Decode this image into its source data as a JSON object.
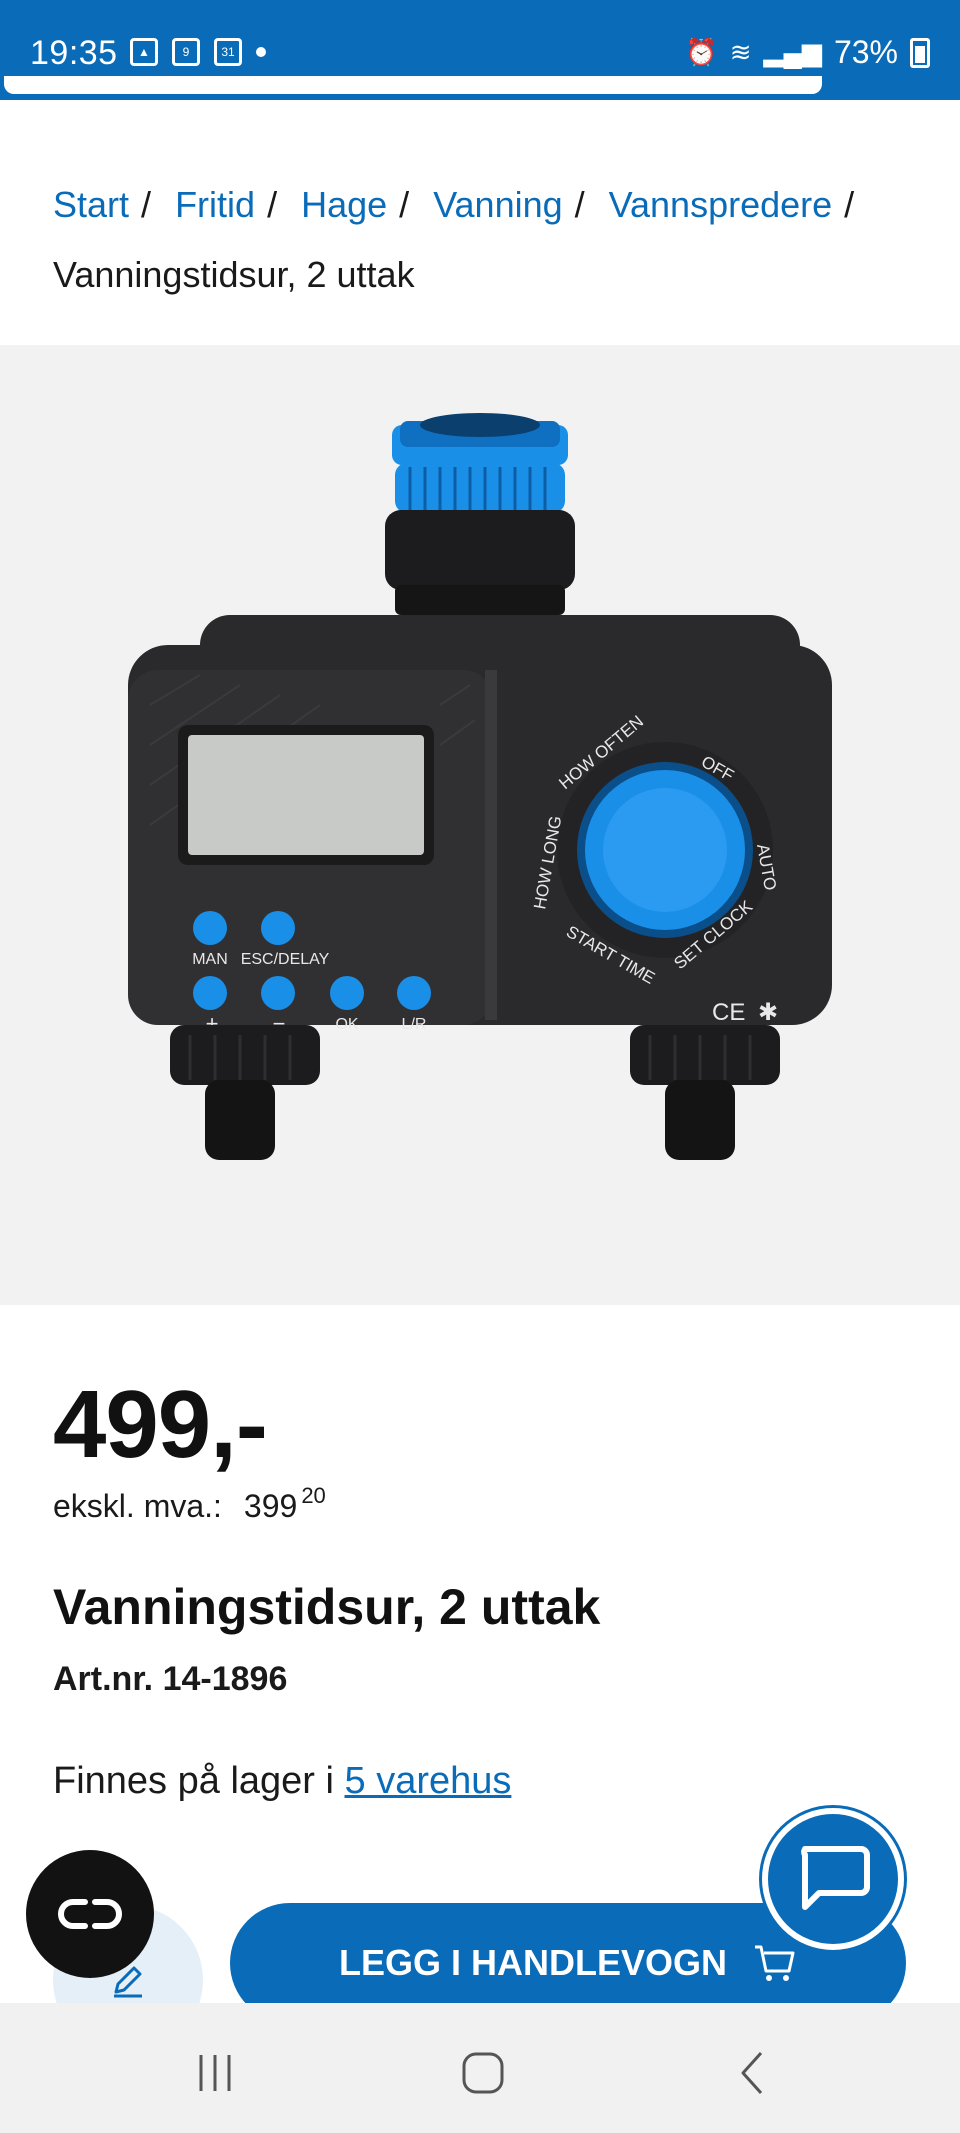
{
  "status_bar": {
    "time": "19:35",
    "calendar_day": "9",
    "calendar_date": "31",
    "battery": "73%",
    "battery_level": 0.73,
    "page_load_progress": 0.86
  },
  "breadcrumb": {
    "items": [
      "Start",
      "Fritid",
      "Hage",
      "Vanning",
      "Vannspredere"
    ],
    "separator": "/",
    "current": "Vanningstidsur, 2 uttak"
  },
  "product": {
    "image_icon": "water-timer-product-image",
    "device_labels": {
      "man": "MAN",
      "esc_delay": "ESC/DELAY",
      "plus": "+",
      "minus": "−",
      "ok": "OK",
      "lr": "L/R",
      "how_often": "HOW OFTEN",
      "off": "OFF",
      "auto": "AUTO",
      "set_clock": "SET CLOCK",
      "start_time": "START TIME",
      "how_long": "HOW LONG",
      "ce": "CE"
    },
    "price": "499,-",
    "exvat_label": "ekskl. mva.:",
    "exvat_value": "399",
    "exvat_decimals": "20",
    "title": "Vanningstidsur, 2 uttak",
    "article_number": "Art.nr. 14-1896",
    "stock_prefix": "Finnes på lager i ",
    "stock_link": "5 varehus"
  },
  "actions": {
    "add_to_cart": "LEGG I HANDLEVOGN",
    "cart_icon": "cart-icon",
    "edit_icon": "pencil-icon",
    "chat_icon": "chat-bubble-icon",
    "assistant_icon": "link-loop-icon"
  },
  "colors": {
    "brand_blue": "#0a6cb8",
    "image_bg": "#f2f2f2",
    "device_body": "#2a2a2c",
    "device_accent": "#1a8fe8"
  },
  "nav": {
    "recent_icon": "recent-apps-icon",
    "home_icon": "home-icon",
    "back_icon": "back-icon"
  }
}
